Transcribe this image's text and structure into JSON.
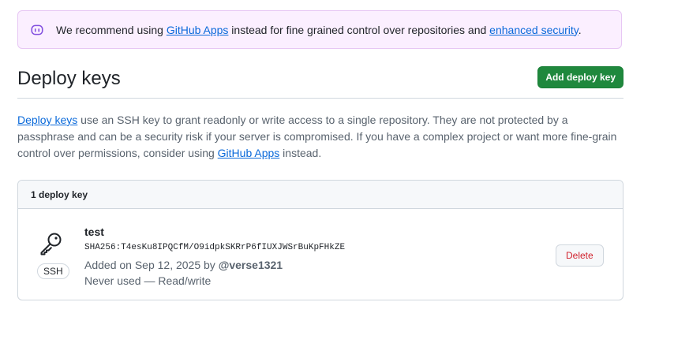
{
  "banner": {
    "icon": "copilot-robot-icon",
    "text_before": "We recommend using ",
    "link_github_apps": "GitHub Apps",
    "text_middle": " instead for fine grained control over repositories and ",
    "link_enhanced_security": "enhanced security",
    "text_after": "."
  },
  "header": {
    "title": "Deploy keys",
    "add_button": "Add deploy key"
  },
  "description": {
    "link_deploy_keys": "Deploy keys",
    "text_1": " use an SSH key to grant readonly or write access to a single repository. They are not protected by a passphrase and can be a security risk if your server is compromised. If you have a complex project or want more fine-grain control over permissions, consider using ",
    "link_github_apps": "GitHub Apps",
    "text_2": " instead."
  },
  "keys_box": {
    "header": "1 deploy key",
    "keys": [
      {
        "icon": "key-icon",
        "badge": "SSH",
        "title": "test",
        "fingerprint": "SHA256:T4esKu8IPQCfM/O9idpkSKRrP6fIUXJWSrBuKpFHkZE",
        "added_prefix": "Added on Sep 12, 2025 by ",
        "added_by": "@verse1321",
        "usage": "Never used — Read/write",
        "delete_button": "Delete"
      }
    ]
  },
  "colors": {
    "primary_button": "#1f883d",
    "link": "#0969da",
    "danger": "#d1242f",
    "banner_bg": "#fbefff"
  }
}
